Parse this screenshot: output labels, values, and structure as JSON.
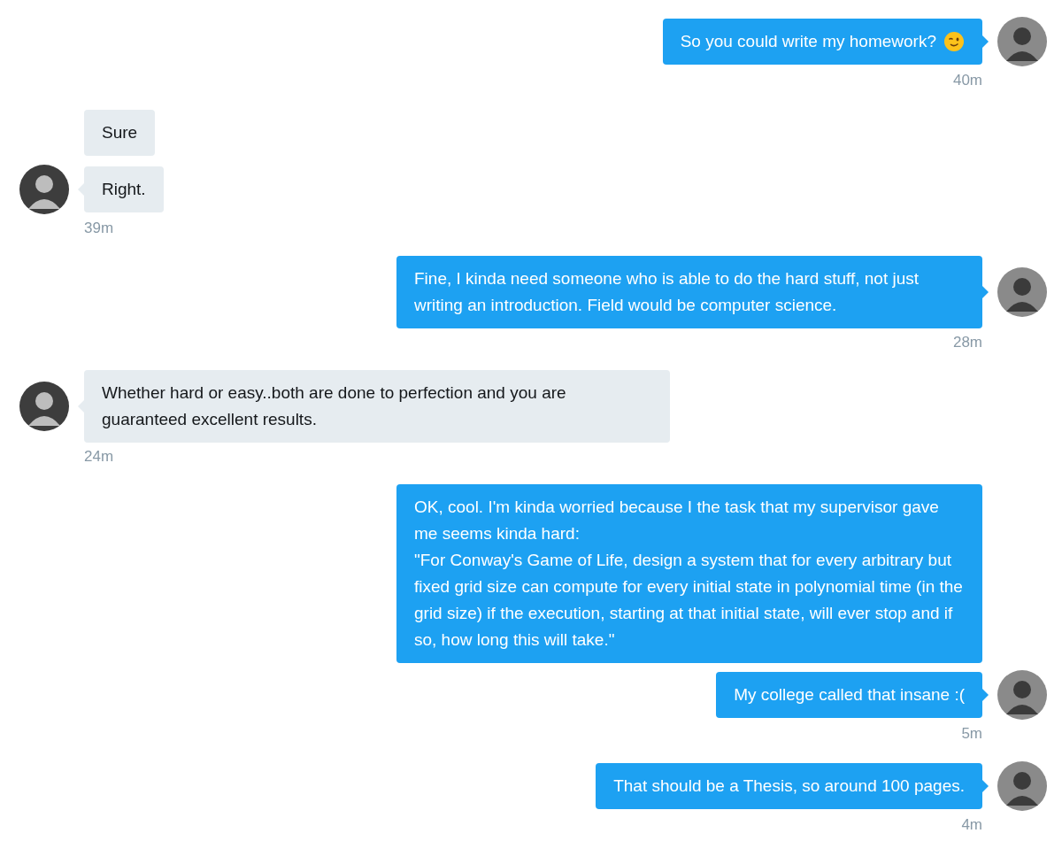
{
  "conversation": [
    {
      "kind": "sent",
      "messages": [
        {
          "kind": "wink",
          "text": "So you could write my homework?"
        }
      ],
      "time": "40m"
    },
    {
      "kind": "received",
      "messages": [
        {
          "kind": "plain",
          "text": "Sure"
        },
        {
          "kind": "plain",
          "text": "Right."
        }
      ],
      "time": "39m"
    },
    {
      "kind": "sent",
      "messages": [
        {
          "kind": "plain",
          "text": "Fine, I kinda need someone who is able to do the hard stuff, not just writing an introduction. Field would be computer science."
        }
      ],
      "time": "28m"
    },
    {
      "kind": "received",
      "messages": [
        {
          "kind": "plain",
          "text": "Whether hard or easy..both are done to perfection and you are guaranteed excellent results."
        }
      ],
      "time": "24m"
    },
    {
      "kind": "sent",
      "messages": [
        {
          "kind": "plain",
          "text": "OK, cool. I'm kinda worried because I the task that my supervisor gave me seems kinda hard:\n\"For Conway's Game of Life, design a system that for every arbitrary but fixed grid size can compute for every initial state in polynomial time (in the grid size) if the execution, starting at that initial state, will ever stop and if so, how long this will take.\""
        },
        {
          "kind": "plain",
          "text": "My college called that insane :("
        }
      ],
      "time": "5m"
    },
    {
      "kind": "sent",
      "messages": [
        {
          "kind": "plain",
          "text": "That should be a Thesis, so around 100 pages."
        }
      ],
      "time": "4m"
    }
  ]
}
